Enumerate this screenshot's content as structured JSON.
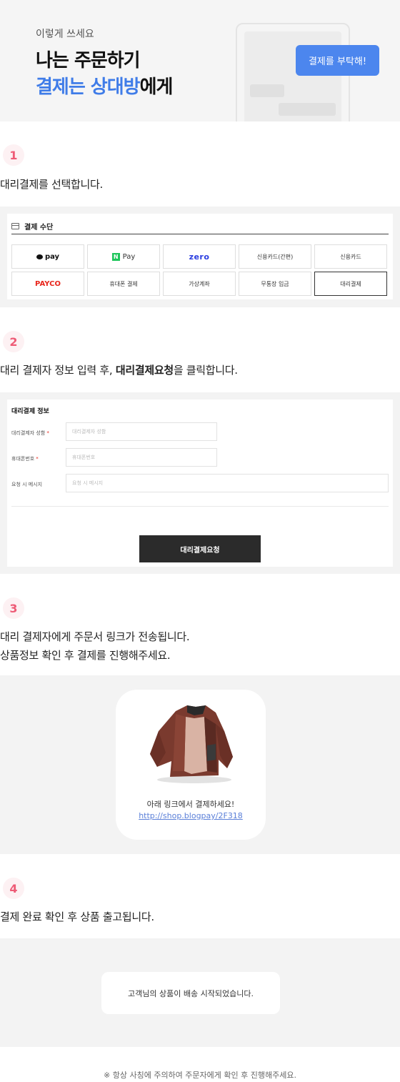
{
  "hero": {
    "subtitle": "이렇게 쓰세요",
    "title_line1": "나는 주문하기",
    "title_line2_blue": "결제는 상대방",
    "title_line2_rest": "에게",
    "bubble": "결제를 부탁해!"
  },
  "steps": [
    {
      "number": "1",
      "text": "대리결제를 선택합니다."
    },
    {
      "number": "2",
      "text_before": "대리 결제자 정보 입력 후, ",
      "text_bold": "대리결제요청",
      "text_after": "을 클릭합니다."
    },
    {
      "number": "3",
      "text_line1": "대리 결제자에게 주문서 링크가 전송됩니다.",
      "text_line2": "상품정보 확인 후 결제를 진행해주세요."
    },
    {
      "number": "4",
      "text": "결제 완료 확인 후 상품 출고됩니다."
    }
  ],
  "payment": {
    "header": "결제 수단",
    "methods": [
      {
        "label": "pay",
        "icon": "kakao-bubble-icon"
      },
      {
        "label": "Pay",
        "icon": "naver-n-icon"
      },
      {
        "label": "zero"
      },
      {
        "label": "신용카드(간편)"
      },
      {
        "label": "신용카드"
      },
      {
        "label": "PAYCO"
      },
      {
        "label": "휴대폰 결제"
      },
      {
        "label": "가상계좌"
      },
      {
        "label": "무통장 입금"
      },
      {
        "label": "대리결제",
        "selected": true
      }
    ]
  },
  "proxy_form": {
    "title": "대리결제 정보",
    "name_label": "대리결제자 성함",
    "name_placeholder": "대리결제자 성함",
    "phone_label": "휴대폰번호",
    "phone_placeholder": "휴대폰번호",
    "message_label": "요청 시 메시지",
    "message_placeholder": "요청 시 메시지",
    "required_mark": "*",
    "submit": "대리결제요청"
  },
  "link_card": {
    "message": "아래 링크에서 결제하세요!",
    "url": "http://shop.blogpay/2F318"
  },
  "notification": {
    "message": "고객님의 상품이 배송 시작되었습니다."
  },
  "footnote": "※ 항상 사칭에 주의하여 주문자에게 확인 후 진행해주세요.",
  "colors": {
    "accent_blue": "#3f7ce8",
    "step_pink": "#ee5b76",
    "dark_button": "#2b2b2b"
  }
}
